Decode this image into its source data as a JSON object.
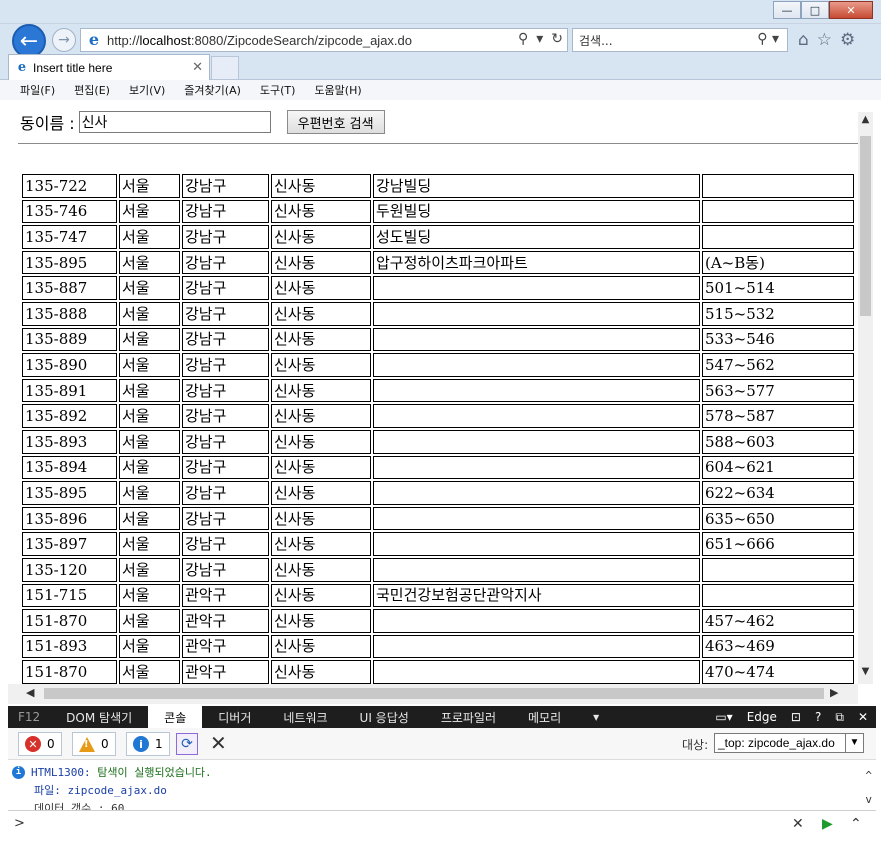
{
  "window": {
    "min": "—",
    "max": "□",
    "close": "✕"
  },
  "nav": {
    "url_prefix": "http://",
    "url_host": "localhost",
    "url_rest": ":8080/ZipcodeSearch/zipcode_ajax.do",
    "search_placeholder": "검색...",
    "search_icon": "search-icon",
    "refresh_icon": "refresh-icon"
  },
  "tab": {
    "title": "Insert title here"
  },
  "menu": [
    "파일(F)",
    "편집(E)",
    "보기(V)",
    "즐겨찾기(A)",
    "도구(T)",
    "도움말(H)"
  ],
  "form": {
    "label": "동이름 :",
    "value": "신사",
    "button": "우편번호 검색"
  },
  "rows": [
    [
      "135-722",
      "서울",
      "강남구",
      "신사동",
      "강남빌딩",
      ""
    ],
    [
      "135-746",
      "서울",
      "강남구",
      "신사동",
      "두원빌딩",
      ""
    ],
    [
      "135-747",
      "서울",
      "강남구",
      "신사동",
      "성도빌딩",
      ""
    ],
    [
      "135-895",
      "서울",
      "강남구",
      "신사동",
      "압구정하이츠파크아파트",
      "(A~B동)"
    ],
    [
      "135-887",
      "서울",
      "강남구",
      "신사동",
      "",
      "501~514"
    ],
    [
      "135-888",
      "서울",
      "강남구",
      "신사동",
      "",
      "515~532"
    ],
    [
      "135-889",
      "서울",
      "강남구",
      "신사동",
      "",
      "533~546"
    ],
    [
      "135-890",
      "서울",
      "강남구",
      "신사동",
      "",
      "547~562"
    ],
    [
      "135-891",
      "서울",
      "강남구",
      "신사동",
      "",
      "563~577"
    ],
    [
      "135-892",
      "서울",
      "강남구",
      "신사동",
      "",
      "578~587"
    ],
    [
      "135-893",
      "서울",
      "강남구",
      "신사동",
      "",
      "588~603"
    ],
    [
      "135-894",
      "서울",
      "강남구",
      "신사동",
      "",
      "604~621"
    ],
    [
      "135-895",
      "서울",
      "강남구",
      "신사동",
      "",
      "622~634"
    ],
    [
      "135-896",
      "서울",
      "강남구",
      "신사동",
      "",
      "635~650"
    ],
    [
      "135-897",
      "서울",
      "강남구",
      "신사동",
      "",
      "651~666"
    ],
    [
      "135-120",
      "서울",
      "강남구",
      "신사동",
      "",
      ""
    ],
    [
      "151-715",
      "서울",
      "관악구",
      "신사동",
      "국민건강보험공단관악지사",
      ""
    ],
    [
      "151-870",
      "서울",
      "관악구",
      "신사동",
      "",
      "457~462"
    ],
    [
      "151-893",
      "서울",
      "관악구",
      "신사동",
      "",
      "463~469"
    ],
    [
      "151-870",
      "서울",
      "관악구",
      "신사동",
      "",
      "470~474"
    ]
  ],
  "devtools": {
    "f12": "F12",
    "tabs": [
      "DOM 탐색기",
      "콘솔",
      "디버거",
      "네트워크",
      "UI 응답성",
      "프로파일러",
      "메모리"
    ],
    "active_tab": "콘솔",
    "mode": "Edge",
    "help": "?",
    "errors": "0",
    "warnings": "0",
    "infos": "1",
    "target_label": "대상:",
    "target_value": "_top: zipcode_ajax.do",
    "console": {
      "code": "HTML1300:",
      "message": "탐색이 실행되었습니다.",
      "file": "파일: zipcode_ajax.do",
      "count": "데이터 갯수 : 60"
    },
    "prompt": ">"
  }
}
